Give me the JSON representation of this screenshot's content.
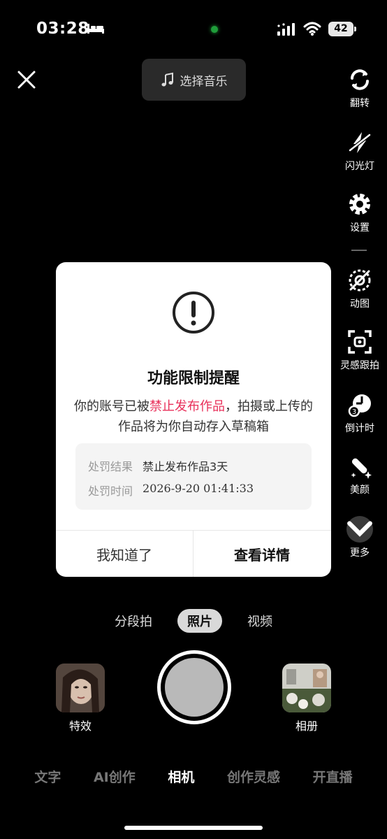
{
  "status": {
    "time": "03:28",
    "battery": "42"
  },
  "top": {
    "music_label": "选择音乐"
  },
  "rail": [
    {
      "label": "翻转",
      "icon": "flip-icon"
    },
    {
      "label": "闪光灯",
      "icon": "flash-off-icon"
    },
    {
      "label": "设置",
      "icon": "gear-icon"
    },
    {
      "label": "动图",
      "icon": "gif-off-icon"
    },
    {
      "label": "灵感跟拍",
      "icon": "inspiration-icon"
    },
    {
      "label": "倒计时",
      "icon": "timer-icon"
    },
    {
      "label": "美颜",
      "icon": "beauty-icon"
    },
    {
      "label": "更多",
      "icon": "chevron-down-icon"
    }
  ],
  "dialog": {
    "title": "功能限制提醒",
    "msg_pre": "你的账号已被",
    "msg_hl": "禁止发布作品",
    "msg_post": "，拍摄或上传的作品将为你自动存入草稿箱",
    "result_key": "处罚结果",
    "result_val": "禁止发布作品3天",
    "time_key": "处罚时间",
    "time_val": "2026-9-20 01:41:33",
    "btn_ok": "我知道了",
    "btn_detail": "查看详情"
  },
  "modes": [
    "分段拍",
    "照片",
    "视频"
  ],
  "capture": {
    "effects_label": "特效",
    "album_label": "相册"
  },
  "tabs": [
    "文字",
    "AI创作",
    "相机",
    "创作灵感",
    "开直播"
  ]
}
